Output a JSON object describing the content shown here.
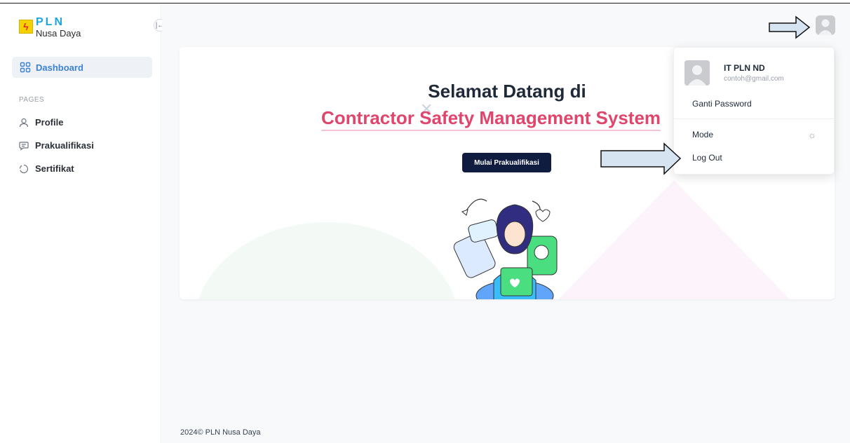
{
  "brand": {
    "title": "PLN",
    "subtitle": "Nusa Daya"
  },
  "sidebar": {
    "active_item": "Dashboard",
    "section_label": "PAGES",
    "items": [
      {
        "label": "Profile",
        "icon": "user-icon"
      },
      {
        "label": "Prakualifikasi",
        "icon": "chat-icon"
      },
      {
        "label": "Sertifikat",
        "icon": "certificate-icon"
      }
    ]
  },
  "hero": {
    "title": "Selamat Datang di",
    "subtitle": "Contractor Safety Management System",
    "button_label": "Mulai Prakualifikasi"
  },
  "user_menu": {
    "name": "IT PLN ND",
    "email": "contoh@gmail.com",
    "items": [
      "Ganti Password",
      "Mode",
      "Log Out"
    ]
  },
  "footer": {
    "text": "2024© PLN Nusa Daya"
  },
  "colors": {
    "accent_blue": "#3b82d6",
    "brand_pink": "#e0456b",
    "button_dark": "#0f1c3f",
    "logo_blue": "#1ea5e0"
  }
}
